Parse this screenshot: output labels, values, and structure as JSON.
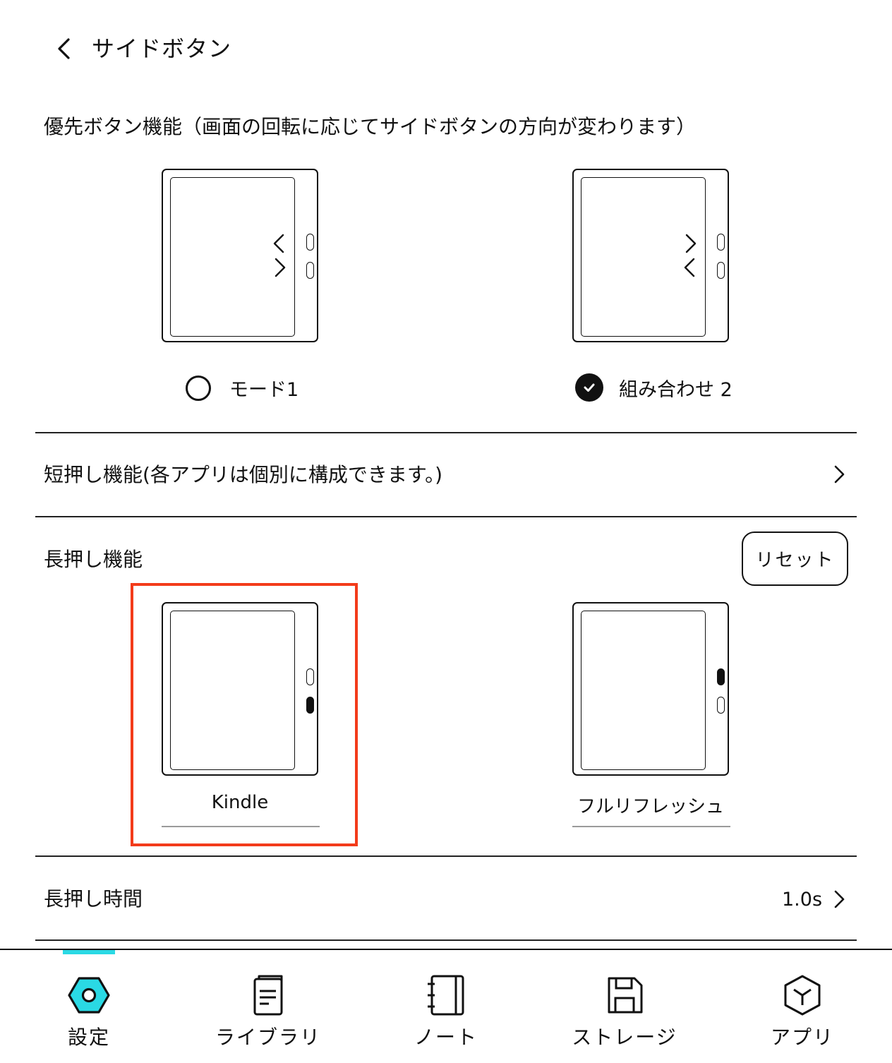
{
  "header": {
    "title": "サイドボタン",
    "back_icon": "chevron-left-icon"
  },
  "priority": {
    "label": "優先ボタン機能（画面の回転に応じてサイドボタンの方向が変わります）",
    "options": [
      {
        "label": "モード1",
        "selected": false
      },
      {
        "label": "組み合わせ 2",
        "selected": true
      }
    ]
  },
  "short_press": {
    "label": "短押し機能(各アプリは個別に構成できます。)"
  },
  "long_press": {
    "label": "長押し機能",
    "reset_label": "リセット",
    "devices": [
      {
        "caption": "Kindle",
        "highlighted": true
      },
      {
        "caption": "フルリフレッシュ",
        "highlighted": false
      }
    ]
  },
  "long_press_time": {
    "label": "長押し時間",
    "value": "1.0s"
  },
  "nav": {
    "items": [
      {
        "label": "設定",
        "icon": "settings-hex-icon",
        "active": true
      },
      {
        "label": "ライブラリ",
        "icon": "library-icon",
        "active": false
      },
      {
        "label": "ノート",
        "icon": "notebook-icon",
        "active": false
      },
      {
        "label": "ストレージ",
        "icon": "storage-icon",
        "active": false
      },
      {
        "label": "アプリ",
        "icon": "apps-cube-icon",
        "active": false
      }
    ]
  },
  "colors": {
    "highlight": "#f33b1a",
    "accent": "#2ad9e4"
  }
}
